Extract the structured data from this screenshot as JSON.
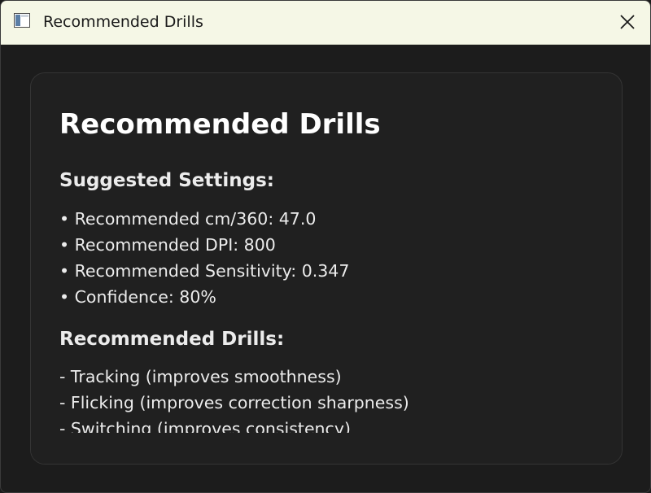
{
  "window": {
    "title": "Recommended Drills",
    "app_icon": "app-window-icon",
    "close_icon": "close-icon"
  },
  "card": {
    "title": "Recommended Drills",
    "settings": {
      "heading": "Suggested Settings:",
      "items": [
        "• Recommended cm/360: 47.0",
        "• Recommended DPI: 800",
        "• Recommended Sensitivity: 0.347",
        "• Confidence: 80%"
      ]
    },
    "drills": {
      "heading": "Recommended Drills:",
      "items": [
        "- Tracking (improves smoothness)",
        "- Flicking (improves correction sharpness)",
        "- Switching (improves consistency)"
      ]
    }
  },
  "colors": {
    "titlebar_bg": "#f5f7e6",
    "window_bg": "#1c1c1c",
    "card_bg": "#202020",
    "text": "#ececec"
  }
}
